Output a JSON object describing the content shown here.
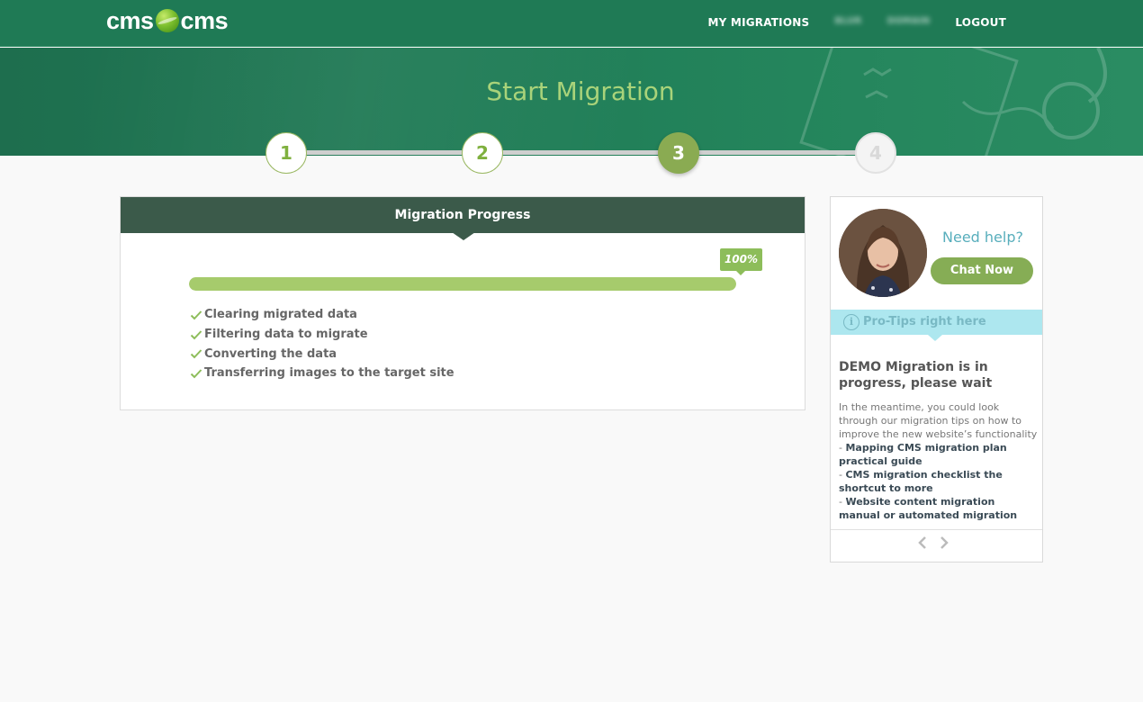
{
  "header": {
    "logo": {
      "left": "cms",
      "right": "cms",
      "icon": "globe-logo-icon"
    },
    "nav": [
      {
        "label": "MY MIGRATIONS",
        "blurred": false
      },
      {
        "label": "BLUR",
        "blurred": true
      },
      {
        "label": "DOMAIN",
        "blurred": true
      },
      {
        "label": "LOGOUT",
        "blurred": false
      }
    ]
  },
  "hero": {
    "title": "Start Migration"
  },
  "steps": [
    {
      "number": "1",
      "state": "done"
    },
    {
      "number": "2",
      "state": "done"
    },
    {
      "number": "3",
      "state": "active"
    },
    {
      "number": "4",
      "state": "todo"
    }
  ],
  "progress_panel": {
    "title": "Migration Progress",
    "percent_label": "100%",
    "percent_value": 100,
    "tasks": [
      {
        "label": "Clearing migrated data",
        "icon": "check-icon"
      },
      {
        "label": "Filtering data to migrate",
        "icon": "check-icon"
      },
      {
        "label": "Converting the data",
        "icon": "check-icon"
      },
      {
        "label": "Transferring images to the target site",
        "icon": "check-icon"
      }
    ]
  },
  "help": {
    "need_help": "Need help?",
    "chat_button": "Chat Now",
    "tips_label": "Pro-Tips right here",
    "tips_icon": "info-icon",
    "demo_title": "DEMO Migration is in progress, please wait",
    "intro": "In the meantime, you could look through our migration tips on how to improve the new website’s functionality",
    "links": [
      "Mapping CMS migration plan practical guide",
      "CMS migration checklist the shortcut to more",
      "Website content migration manual or automated migration"
    ],
    "prev_icon": "chevron-left-icon",
    "next_icon": "chevron-right-icon"
  },
  "colors": {
    "header_bg": "#1f7a55",
    "accent_green": "#86ad55",
    "progress_fill": "#a6cb6c",
    "panel_head": "#3b5a4a",
    "help_blue": "#58aebc",
    "tips_bg": "#ade7ef"
  }
}
